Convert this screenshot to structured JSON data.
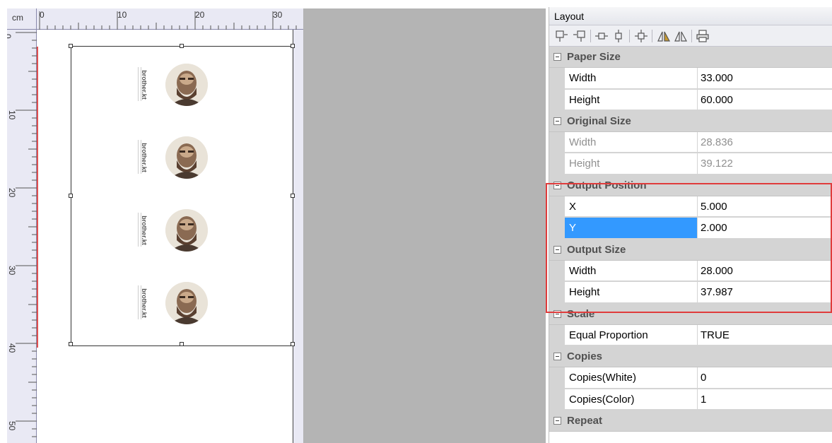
{
  "ruler": {
    "unit": "cm",
    "h_labels": [
      "0",
      "10",
      "20",
      "30"
    ],
    "v_labels": [
      "0",
      "10",
      "20",
      "30",
      "40",
      "50"
    ]
  },
  "canvas": {
    "stamp_text": "brother.kt"
  },
  "panel": {
    "title": "Layout",
    "toolbar_icons": [
      "align-left-icon",
      "align-right-icon",
      "center-horizontal-icon",
      "center-vertical-icon",
      "center-both-icon",
      "mirror-color-icon",
      "mirror-icon",
      "printer-icon"
    ],
    "categories": [
      {
        "id": "paper-size",
        "label": "Paper Size",
        "rows": [
          {
            "name": "Width",
            "value": "33.000"
          },
          {
            "name": "Height",
            "value": "60.000"
          }
        ]
      },
      {
        "id": "original-size",
        "label": "Original Size",
        "rows": [
          {
            "name": "Width",
            "value": "28.836"
          },
          {
            "name": "Height",
            "value": "39.122"
          }
        ]
      },
      {
        "id": "output-position",
        "label": "Output Position",
        "rows": [
          {
            "name": "X",
            "value": "5.000"
          },
          {
            "name": "Y",
            "value": "2.000"
          }
        ]
      },
      {
        "id": "output-size",
        "label": "Output Size",
        "rows": [
          {
            "name": "Width",
            "value": "28.000"
          },
          {
            "name": "Height",
            "value": "37.987"
          }
        ]
      },
      {
        "id": "scale",
        "label": "Scale",
        "rows": [
          {
            "name": "Equal Proportion",
            "value": "TRUE"
          }
        ]
      },
      {
        "id": "copies",
        "label": "Copies",
        "rows": [
          {
            "name": "Copies(White)",
            "value": "0"
          },
          {
            "name": "Copies(Color)",
            "value": "1"
          }
        ]
      },
      {
        "id": "repeat",
        "label": "Repeat",
        "rows": []
      }
    ]
  },
  "colors": {
    "highlight": "#e03c3c",
    "selection": "#3399ff",
    "category_bg": "#d4d4d4",
    "workspace_gray": "#b4b4b4"
  }
}
